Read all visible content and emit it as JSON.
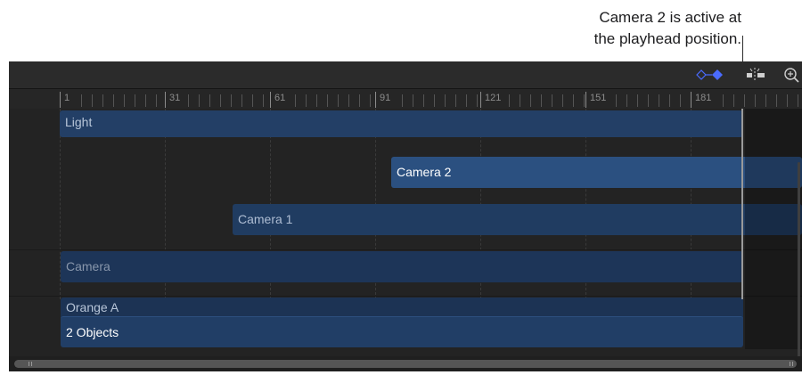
{
  "callout": {
    "line1": "Camera 2 is active at",
    "line2": "the playhead position."
  },
  "toolbar": {
    "icons": [
      "keyframe-icon",
      "snap-icon",
      "zoom-icon"
    ],
    "keyframe_color": "#4a6bff"
  },
  "ruler": {
    "labels": [
      "1",
      "31",
      "61",
      "91",
      "121",
      "151",
      "181"
    ]
  },
  "tracks": [
    {
      "label": "Light"
    },
    {
      "label": "Camera 2"
    },
    {
      "label": "Camera 1"
    },
    {
      "label": "Camera"
    },
    {
      "label": "Orange A"
    },
    {
      "label": "2 Objects"
    }
  ],
  "colors": {
    "panel_bg": "#232323",
    "bar_blue": "#2b5080"
  }
}
